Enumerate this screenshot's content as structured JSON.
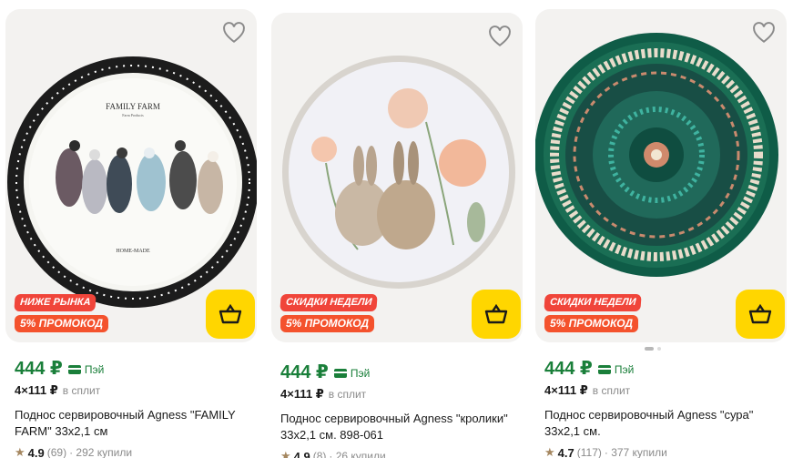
{
  "cards": [
    {
      "badge_top": "НИЖЕ РЫНКА",
      "badge_promo": "5% ПРОМОКОД",
      "price": "444 ₽",
      "pay_label": "Пэй",
      "split_amount": "4×111 ₽",
      "split_label": "в сплит",
      "title": "Поднос сервировочный Agness \"FAMILY FARM\" 33х2,1 см",
      "rating": "4.9",
      "reviews": "(69)",
      "bought": "· 292 купили",
      "plate_text_top": "FAMILY FARM",
      "plate_text_sub": "Farm Products",
      "plate_text_bottom": "HOME-MADE"
    },
    {
      "badge_top": "СКИДКИ НЕДЕЛИ",
      "badge_promo": "5% ПРОМОКОД",
      "price": "444 ₽",
      "pay_label": "Пэй",
      "split_amount": "4×111 ₽",
      "split_label": "в сплит",
      "title": "Поднос сервировочный Agness \"кролики\" 33х2,1 см. 898-061",
      "rating": "4.9",
      "reviews": "(8)",
      "bought": "· 26 купили"
    },
    {
      "badge_top": "СКИДКИ НЕДЕЛИ",
      "badge_promo": "5% ПРОМОКОД",
      "price": "444 ₽",
      "pay_label": "Пэй",
      "split_amount": "4×111 ₽",
      "split_label": "в сплит",
      "title": "Поднос сервировочный Agness \"сура\" 33х2,1 см.",
      "rating": "4.7",
      "reviews": "(117)",
      "bought": "· 377 купили"
    }
  ],
  "icons": {
    "favorite": "heart-outline-icon",
    "cart": "basket-icon",
    "star": "star-icon",
    "pay": "card-icon"
  },
  "colors": {
    "price_green": "#1a7f3a",
    "cart_yellow": "#ffd600",
    "badge_red": "#f0453a",
    "promo_orange": "#f4522d"
  }
}
